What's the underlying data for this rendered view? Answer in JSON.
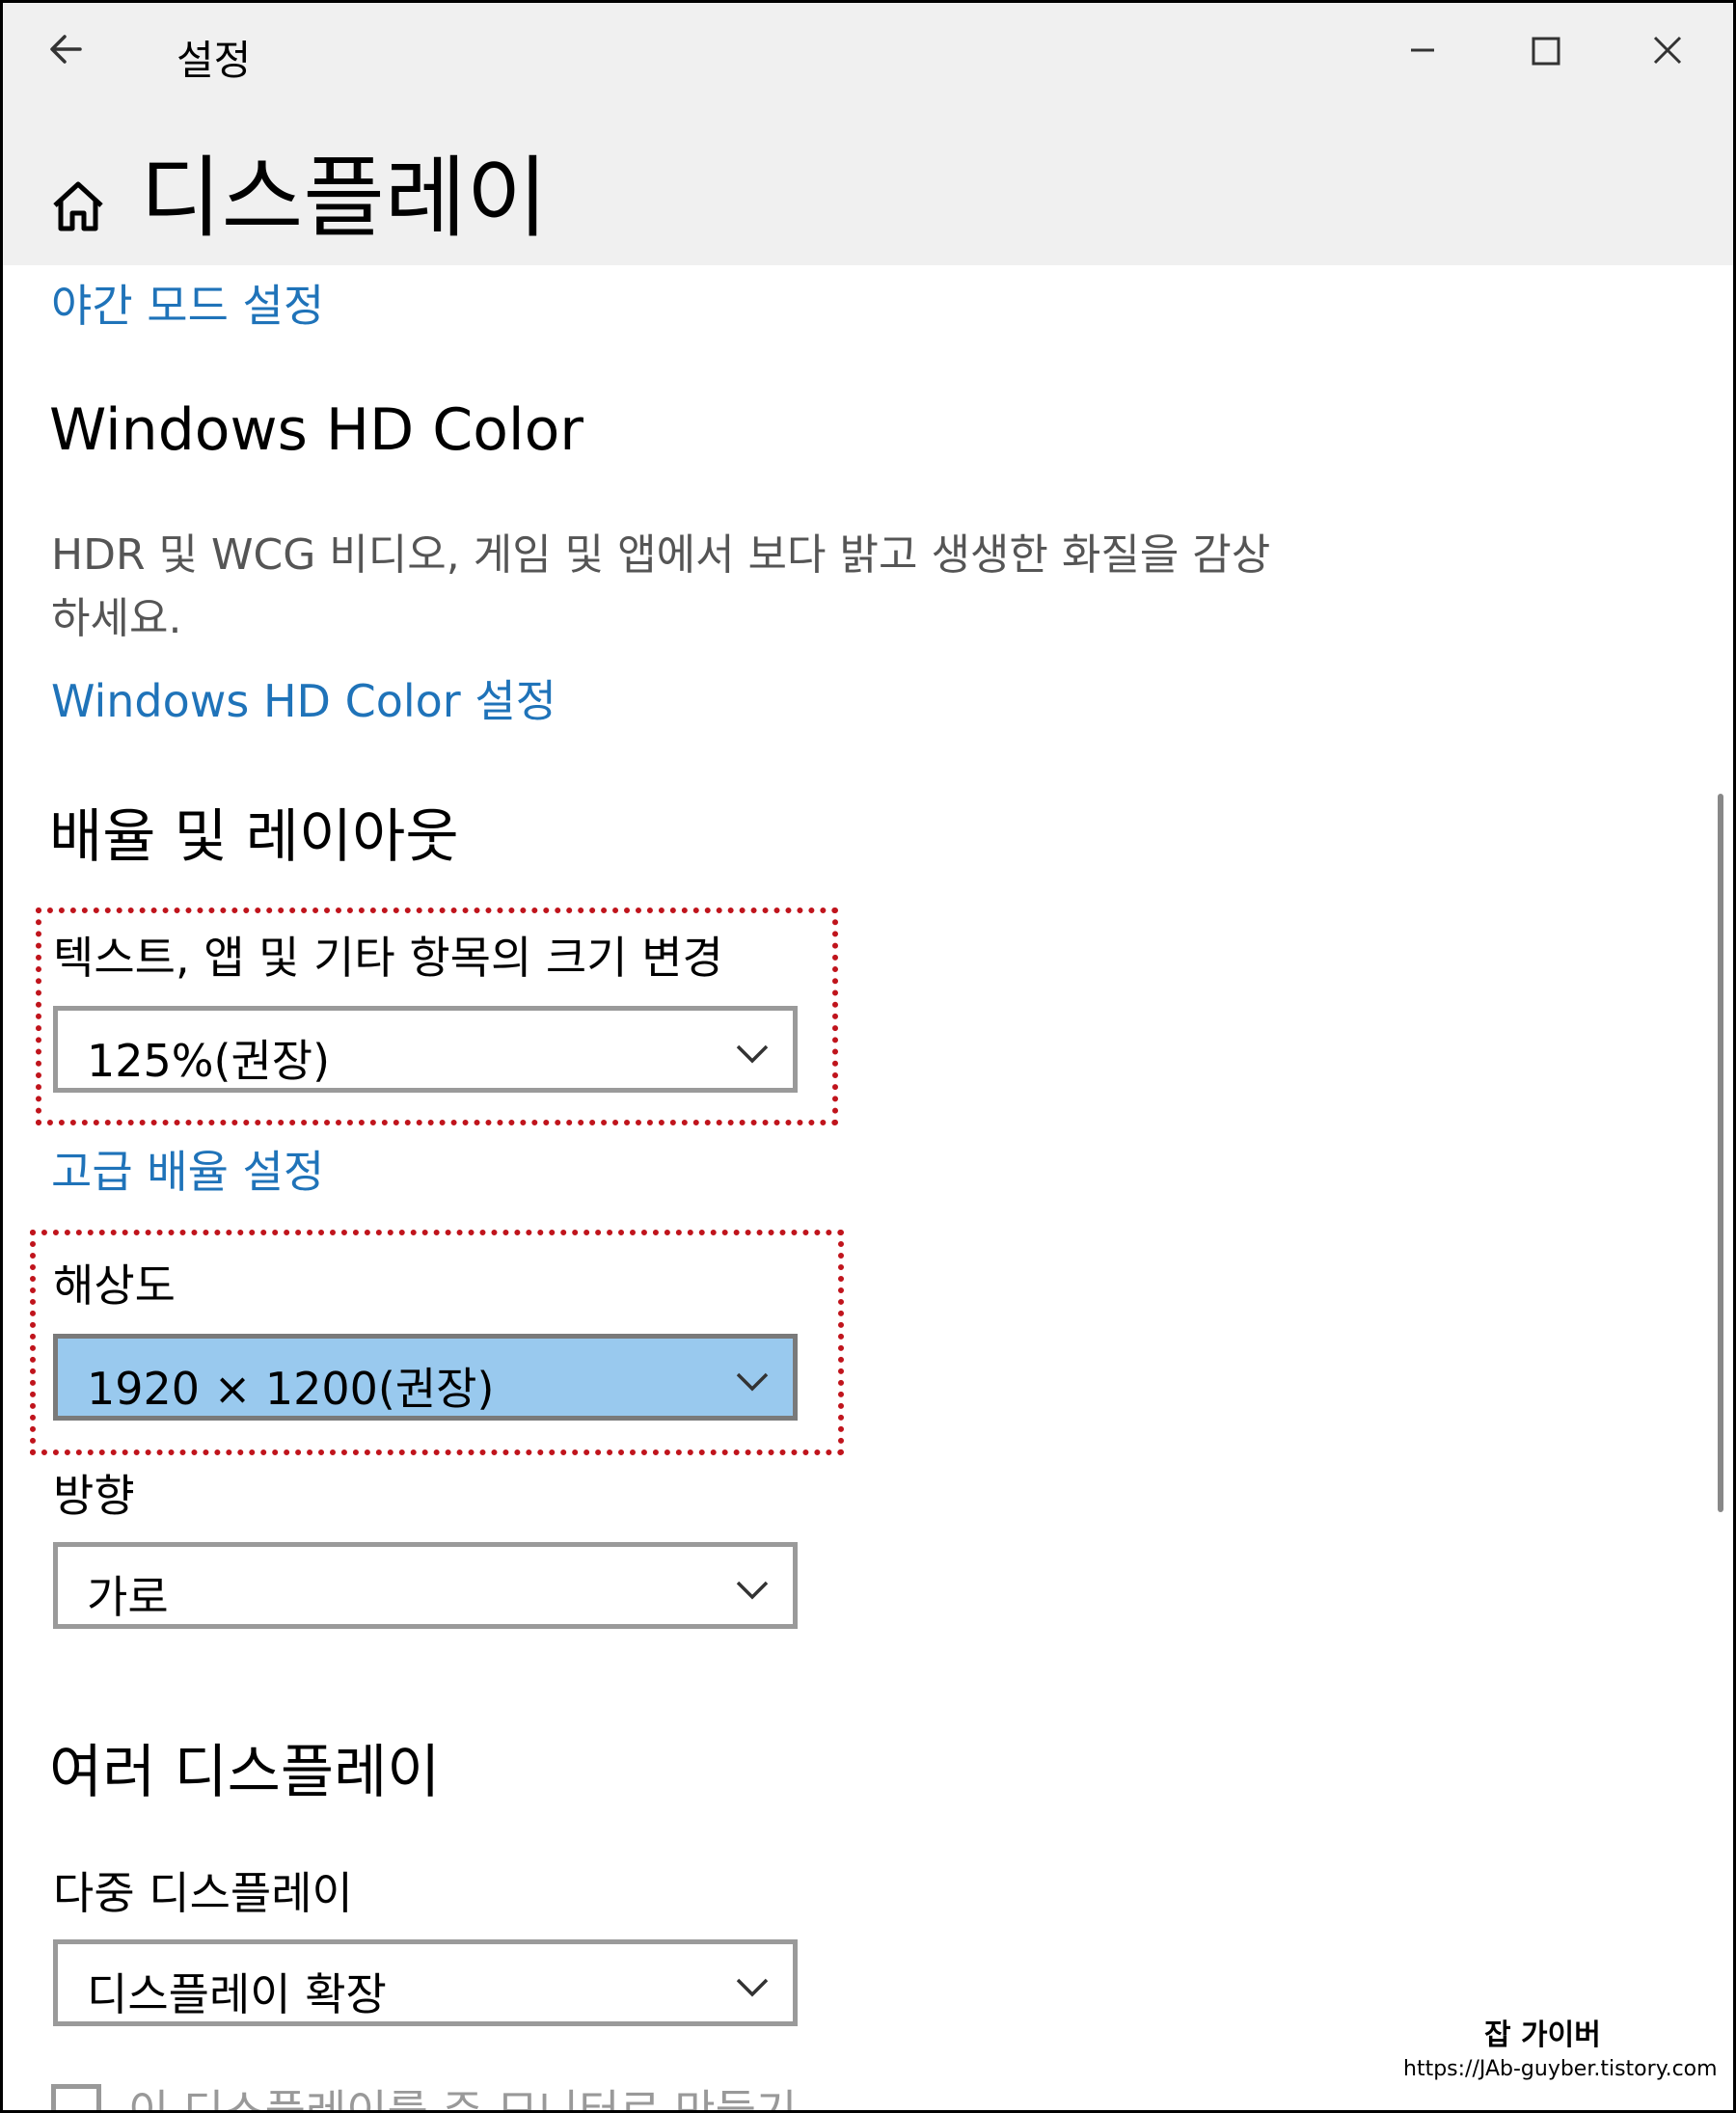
{
  "window": {
    "app_title": "설정",
    "page_title": "디스플레이"
  },
  "links": {
    "night_mode": "야간 모드 설정",
    "hd_color": "Windows HD Color 설정",
    "advanced_scaling": "고급 배율 설정"
  },
  "hd_color": {
    "heading": "Windows HD Color",
    "description": "HDR 및 WCG 비디오, 게임 및 앱에서 보다 밝고 생생한 화질을 감상하세요."
  },
  "scale_layout": {
    "heading": "배율 및 레이아웃",
    "scale_label": "텍스트, 앱 및 기타 항목의 크기 변경",
    "scale_value": "125%(권장)",
    "resolution_label": "해상도",
    "resolution_value": "1920 × 1200(권장)",
    "orientation_label": "방향",
    "orientation_value": "가로"
  },
  "multi_display": {
    "heading": "여러 디스플레이",
    "label": "다중 디스플레이",
    "value": "디스플레이 확장",
    "checkbox_label": "이 디스플레이를 주 모니터로 만들기"
  },
  "watermark": {
    "name": "잡 가이버",
    "url": "https://JAb-guyber.tistory.com"
  },
  "colors": {
    "link": "#1f73b9",
    "selected_dropdown": "#99c9ee",
    "highlight_border": "#c0141c",
    "titlebar_bg": "#f0f0f0"
  }
}
